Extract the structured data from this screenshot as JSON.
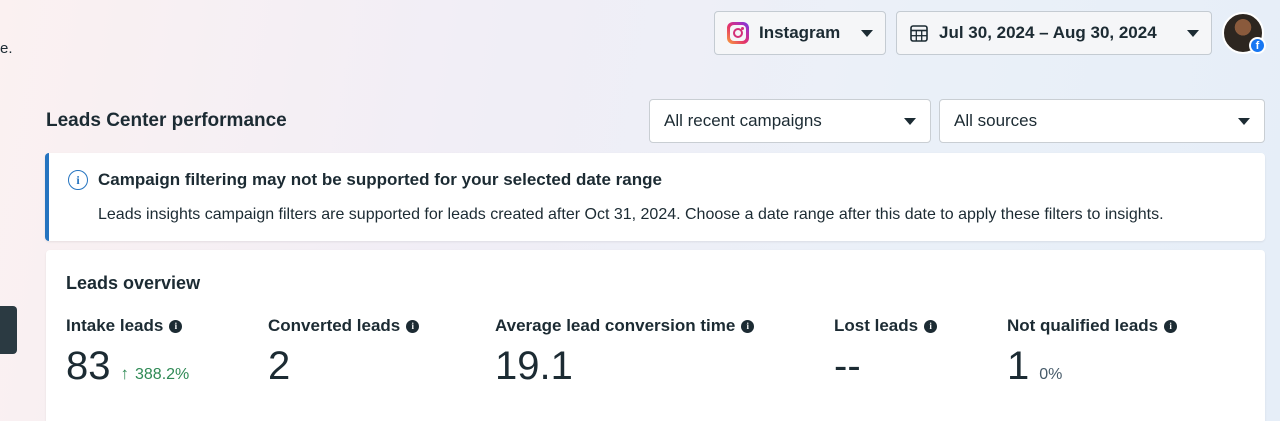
{
  "fragment_text": "e.",
  "header": {
    "platform_label": "Instagram",
    "date_range": "Jul 30, 2024 – Aug 30, 2024"
  },
  "section": {
    "title": "Leads Center performance",
    "campaign_filter": "All recent campaigns",
    "source_filter": "All sources"
  },
  "banner": {
    "title": "Campaign filtering may not be supported for your selected date range",
    "text": "Leads insights campaign filters are supported for leads created after Oct 31, 2024. Choose a date range after this date to apply these filters to insights."
  },
  "overview": {
    "title": "Leads overview",
    "metrics": [
      {
        "label": "Intake leads",
        "value": "83",
        "delta": "388.2%"
      },
      {
        "label": "Converted leads",
        "value": "2"
      },
      {
        "label": "Average lead conversion time",
        "value": "19.1"
      },
      {
        "label": "Lost leads",
        "value": "--"
      },
      {
        "label": "Not qualified leads",
        "value": "1",
        "pct": "0%"
      }
    ]
  },
  "colors": {
    "accent_blue": "#2574c0",
    "positive_green": "#2f8a55",
    "text": "#1c2b33"
  },
  "icons": [
    "instagram-icon",
    "calendar-icon",
    "chevron-down-icon",
    "info-icon",
    "arrow-up-icon",
    "facebook-icon"
  ]
}
